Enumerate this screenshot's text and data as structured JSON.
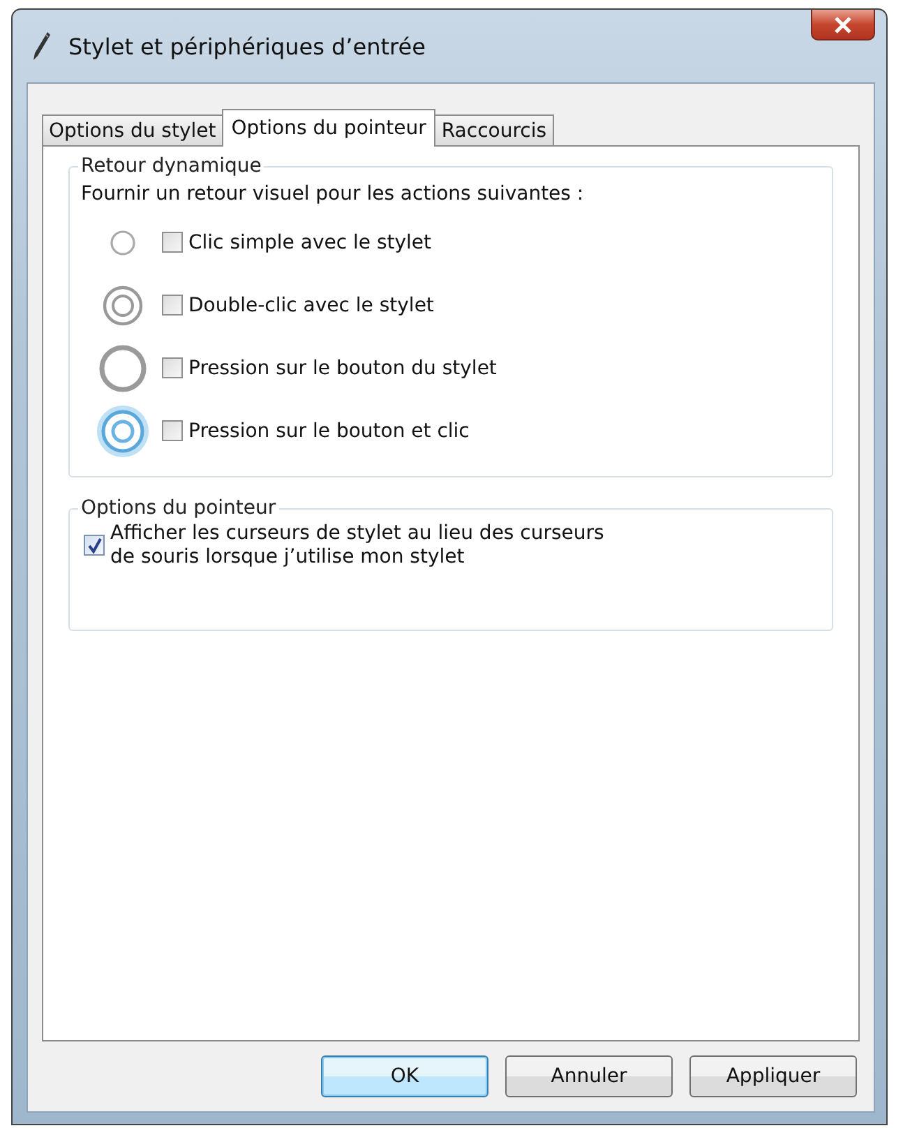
{
  "window": {
    "title": "Stylet et périphériques d’entrée"
  },
  "tabs": [
    {
      "label": "Options du stylet",
      "selected": false
    },
    {
      "label": "Options du pointeur",
      "selected": true
    },
    {
      "label": "Raccourcis",
      "selected": false
    }
  ],
  "feedback_group": {
    "title": "Retour dynamique",
    "intro": "Fournir un retour visuel pour les actions suivantes :",
    "items": [
      {
        "kind": "tap",
        "label": "Clic simple avec le stylet",
        "checked": false
      },
      {
        "kind": "double_tap",
        "label": "Double-clic avec le stylet",
        "checked": false
      },
      {
        "kind": "press",
        "label": "Pression sur le bouton du stylet",
        "checked": false
      },
      {
        "kind": "press_tap",
        "label": "Pression sur le bouton et clic",
        "checked": false
      }
    ]
  },
  "pointer_group": {
    "title": "Options du pointeur",
    "items": [
      {
        "label": "Afficher les curseurs de stylet au lieu des curseurs\nde souris lorsque j’utilise mon stylet",
        "checked": true
      }
    ]
  },
  "buttons": [
    {
      "label": "OK",
      "default": true
    },
    {
      "label": "Annuler",
      "default": false
    },
    {
      "label": "Appliquer",
      "default": false
    }
  ]
}
